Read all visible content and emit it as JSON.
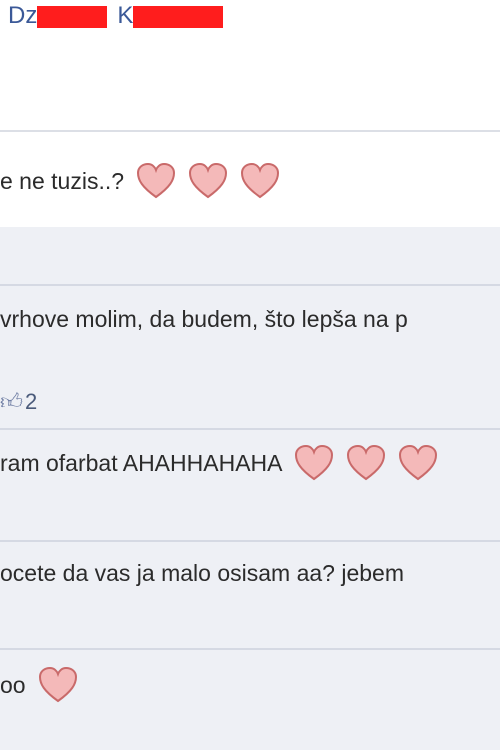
{
  "post": {
    "author_first_visible": "Dz",
    "author_last_visible": "K"
  },
  "comments": [
    {
      "text": "e ne tuzis..?",
      "hearts": 3
    },
    {
      "text": "vrhove molim, da budem, što lepša na p",
      "hearts": 0
    },
    {
      "text": "ram ofarbat AHAHHAHAHA",
      "hearts": 3
    },
    {
      "text": "ocete da vas ja malo osisam aa? jebem",
      "hearts": 0
    },
    {
      "text": "oo",
      "hearts": 1
    }
  ],
  "like": {
    "icon": "thumbs-up-icon",
    "count": "2"
  },
  "colors": {
    "heart_fill": "#f4b9b9",
    "heart_stroke": "#c96a6a",
    "redaction": "#ff1d1d",
    "name_link": "#3b5998",
    "comment_bg": "#eef0f5"
  }
}
